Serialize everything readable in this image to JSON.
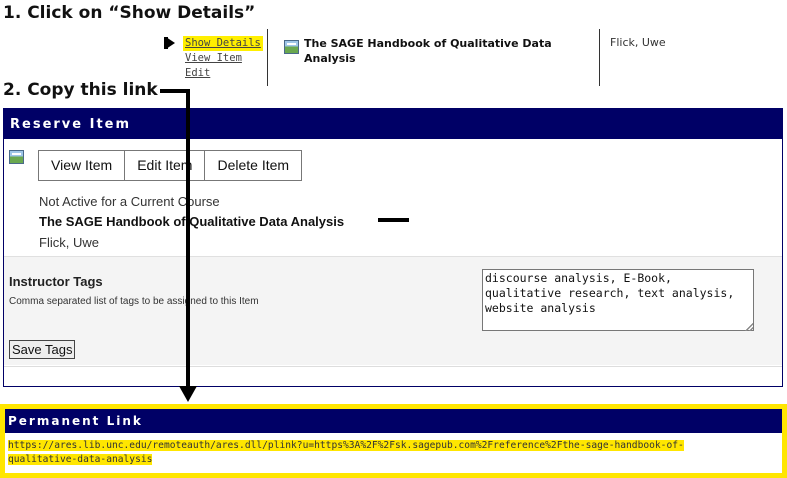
{
  "instructions": {
    "step1": "1. Click on “Show Details”",
    "step2": "2. Copy this link"
  },
  "listing": {
    "show_details": "Show Details",
    "view_item": "View Item",
    "edit": "Edit",
    "title": "The SAGE Handbook of Qualitative Data Analysis",
    "author": "Flick, Uwe",
    "icon": "ebook-icon"
  },
  "reserve_item": {
    "header": "Reserve Item",
    "buttons": {
      "view_item": "View Item",
      "edit_item": "Edit Item",
      "delete_item": "Delete Item"
    },
    "status": "Not Active for a Current Course",
    "title": "The SAGE Handbook of Qualitative Data Analysis",
    "author": "Flick, Uwe",
    "instructor_tags": {
      "label": "Instructor Tags",
      "help": "Comma separated list of tags to be assigned to this Item",
      "value": "discourse analysis, E-Book,\nqualitative research, text analysis,\nwebsite analysis",
      "save_label": "Save Tags"
    }
  },
  "permanent_link": {
    "header": "Permanent Link",
    "url_line1": "https://ares.lib.unc.edu/remoteauth/ares.dll/plink?u=https%3A%2F%2Fsk.sagepub.com%2Freference%2Fthe-sage-handbook-of-",
    "url_line2": "qualitative-data-analysis"
  },
  "colors": {
    "header_bg": "#000066",
    "highlight": "#ffe600"
  }
}
